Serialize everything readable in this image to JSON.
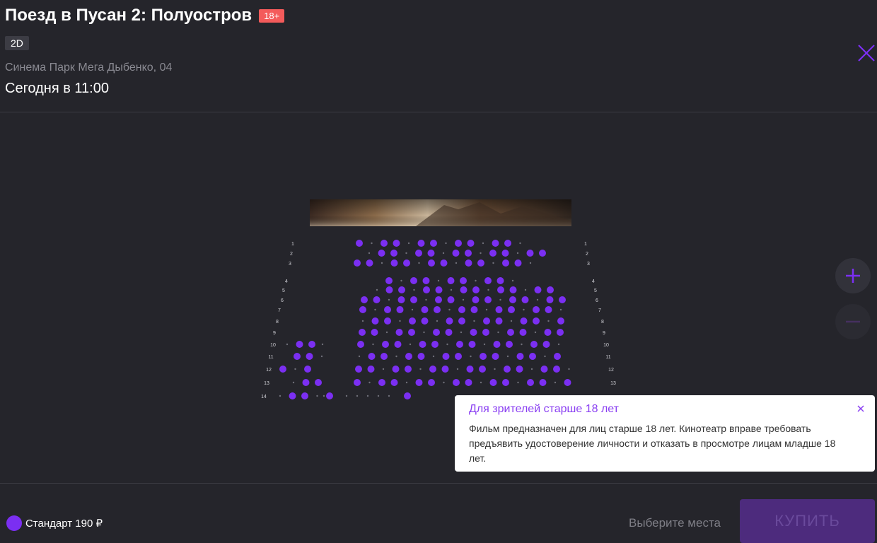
{
  "movie": {
    "title": "Поезд в Пусан 2: Полуостров",
    "age_rating": "18+",
    "format": "2D",
    "cinema": "Синема Парк Мега Дыбенко, 04",
    "datetime": "Сегодня в 11:00"
  },
  "hall": {
    "row_numbers": [
      "1",
      "2",
      "3",
      "4",
      "5",
      "6",
      "7",
      "8",
      "9",
      "10",
      "11",
      "12",
      "13",
      "14"
    ]
  },
  "colors": {
    "accent": "#7b2ff2",
    "background": "#25252b",
    "age_badge": "#f45b5b"
  },
  "icons": [
    "close-icon",
    "plus-icon",
    "minus-icon"
  ],
  "tooltip": {
    "title": "Для зрителей старше 18 лет",
    "text": "Фильм предназначен для лиц старше 18 лет. Кинотеатр вправе требовать предъявить удостоверение личности и отказать в просмотре лицам младше 18 лет."
  },
  "footer": {
    "legend_label": "Стандарт 190 ₽",
    "hint": "Выберите места",
    "buy_label": "КУПИТЬ"
  }
}
